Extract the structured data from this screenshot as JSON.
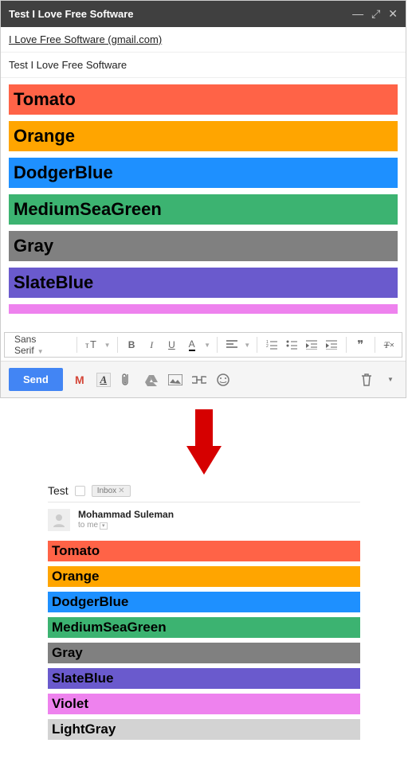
{
  "compose": {
    "title": "Test I Love Free Software",
    "to": "I Love Free Software (gmail.com)",
    "subject": "Test I Love Free Software",
    "body_colors": [
      {
        "name": "Tomato",
        "value": "#ff6347"
      },
      {
        "name": "Orange",
        "value": "#ffa500"
      },
      {
        "name": "DodgerBlue",
        "value": "#1e90ff"
      },
      {
        "name": "MediumSeaGreen",
        "value": "#3cb371"
      },
      {
        "name": "Gray",
        "value": "#808080"
      },
      {
        "name": "SlateBlue",
        "value": "#6a5acd"
      }
    ],
    "format_bar": {
      "font": "Sans Serif",
      "size": "TT",
      "bold": "B",
      "italic": "I",
      "underline": "U",
      "text_color": "A"
    },
    "actions": {
      "send": "Send"
    }
  },
  "received": {
    "subject": "Test",
    "label": "Inbox",
    "sender": "Mohammad Suleman",
    "to_line": "to me",
    "body_colors": [
      {
        "name": "Tomato",
        "value": "#ff6347"
      },
      {
        "name": "Orange",
        "value": "#ffa500"
      },
      {
        "name": "DodgerBlue",
        "value": "#1e90ff"
      },
      {
        "name": "MediumSeaGreen",
        "value": "#3cb371"
      },
      {
        "name": "Gray",
        "value": "#808080"
      },
      {
        "name": "SlateBlue",
        "value": "#6a5acd"
      },
      {
        "name": "Violet",
        "value": "#ee82ee"
      },
      {
        "name": "LightGray",
        "value": "#d3d3d3"
      }
    ]
  }
}
